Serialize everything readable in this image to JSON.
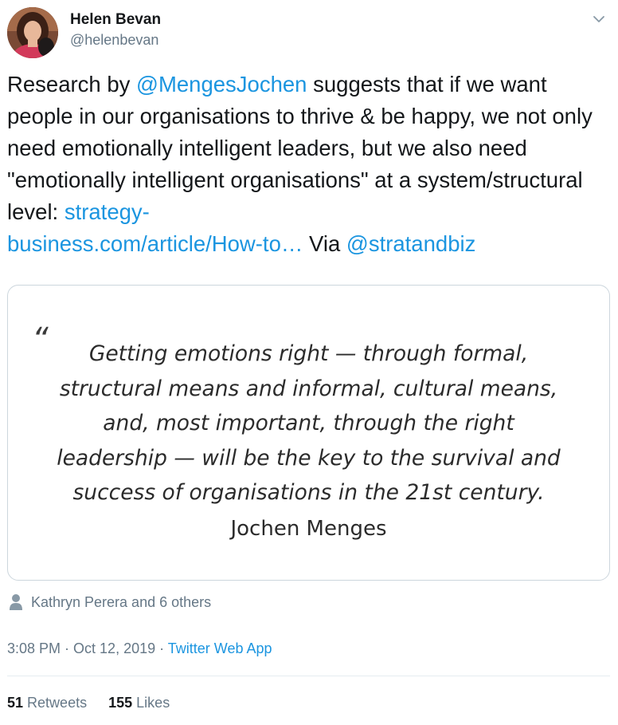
{
  "author": {
    "name": "Helen Bevan",
    "handle": "@helenbevan"
  },
  "tweet": {
    "text_1": "Research by ",
    "mention_1": "@MengesJochen",
    "text_2": " suggests that if we want people in our organisations to thrive & be happy, we not only need emotionally intelligent leaders, but we also need \"emotionally intelligent organisations\" at a system/structural level: ",
    "link_line_1": "strategy-",
    "link_line_2": "business.com/article/How-to…",
    "text_3": " Via ",
    "mention_2": "@stratandbiz"
  },
  "media": {
    "quote_mark": "“",
    "quote_lines": [
      "Getting emotions right — through formal,",
      "structural means and informal, cultural means,",
      "and, most important, through the right",
      "leadership — will be the key to the survival and",
      "success of organisations in the 21st century."
    ],
    "quote_author": "Jochen Menges"
  },
  "likers": {
    "text": "Kathryn Perera and 6 others"
  },
  "meta": {
    "time": "3:08 PM",
    "separator_1": " · ",
    "date": "Oct 12, 2019",
    "separator_2": " · ",
    "source": "Twitter Web App"
  },
  "stats": {
    "retweets_count": "51",
    "retweets_label": "Retweets",
    "likes_count": "155",
    "likes_label": "Likes"
  },
  "colors": {
    "link": "#1b95e0",
    "secondary_text": "#657786",
    "divider": "#e6ecf0"
  },
  "icons": {
    "caret": "chevron-down-icon",
    "person": "person-icon"
  }
}
